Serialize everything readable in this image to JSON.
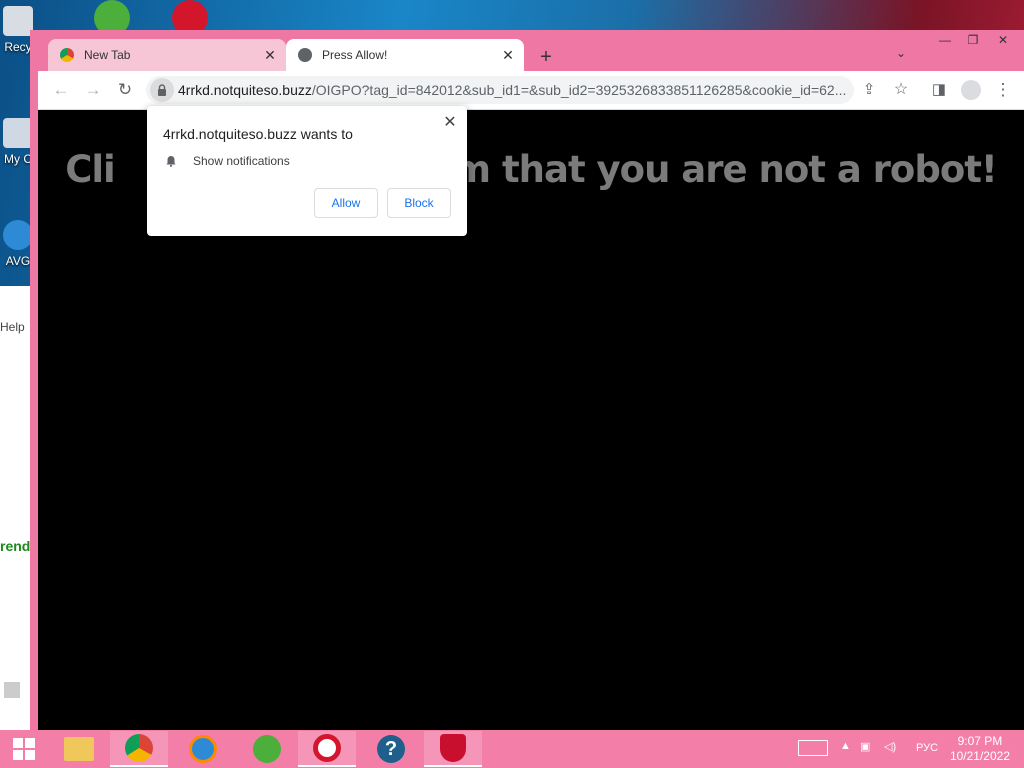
{
  "desktop": {
    "icons": [
      {
        "label": "Recy"
      },
      {
        "label": "My C"
      },
      {
        "label": "AVG"
      }
    ]
  },
  "bg_window": {
    "help": "Help",
    "trending": "rendi"
  },
  "browser": {
    "tabs": [
      {
        "title": "New Tab"
      },
      {
        "title": "Press Allow!"
      }
    ],
    "url_host": "4rrkd.notquiteso.buzz",
    "url_path": "/OIGPO?tag_id=842012&sub_id1=&sub_id2=3925326833851126285&cookie_id=62...",
    "headline": "Click  Allow  to confirm that you are not a robot!",
    "headline_visible": "Cli                          irm that you are not a robot!",
    "popup": {
      "title": "4rrkd.notquiteso.buzz wants to",
      "permission": "Show notifications",
      "allow_label": "Allow",
      "block_label": "Block"
    }
  },
  "taskbar": {
    "tray_lang": "РУС",
    "time": "9:07 PM",
    "date": "10/21/2022"
  },
  "colors": {
    "browser_frame": "#ef77a3",
    "taskbar": "#f37fa9",
    "link_blue": "#1a73e8",
    "headline_gray": "#7b7b7b"
  }
}
